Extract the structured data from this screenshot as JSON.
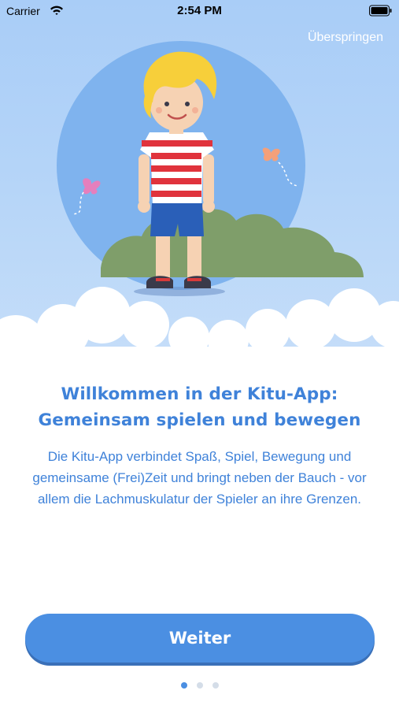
{
  "status_bar": {
    "carrier": "Carrier",
    "time": "2:54 PM",
    "wifi_icon": "wifi-icon",
    "battery_icon": "battery-icon"
  },
  "header": {
    "skip_label": "Überspringen"
  },
  "illustration": {
    "subject": "child-illustration",
    "accent_colors": {
      "sky": "#a9cdf7",
      "sun_circle": "#7fb3ee",
      "bush": "#7f9e6a",
      "shirt_stripe": "#e0333c",
      "shorts": "#2a5fb8",
      "hair": "#f7cf3a",
      "butterfly_left": "#e57fbd",
      "butterfly_right": "#f3a07a"
    }
  },
  "main": {
    "title": "Willkommen in der Kitu-App: Gemeinsam spielen und bewegen",
    "description": "Die Kitu-App verbindet Spaß, Spiel, Bewegung und gemeinsame (Frei)Zeit und bringt neben der Bauch - vor allem die Lachmuskulatur der Spieler an ihre Grenzen."
  },
  "footer": {
    "next_label": "Weiter",
    "pager": {
      "total": 3,
      "active_index": 0
    }
  },
  "colors": {
    "accent": "#4b8fe2",
    "text_blue": "#3f82d9",
    "dot_inactive": "#d4dde8"
  }
}
